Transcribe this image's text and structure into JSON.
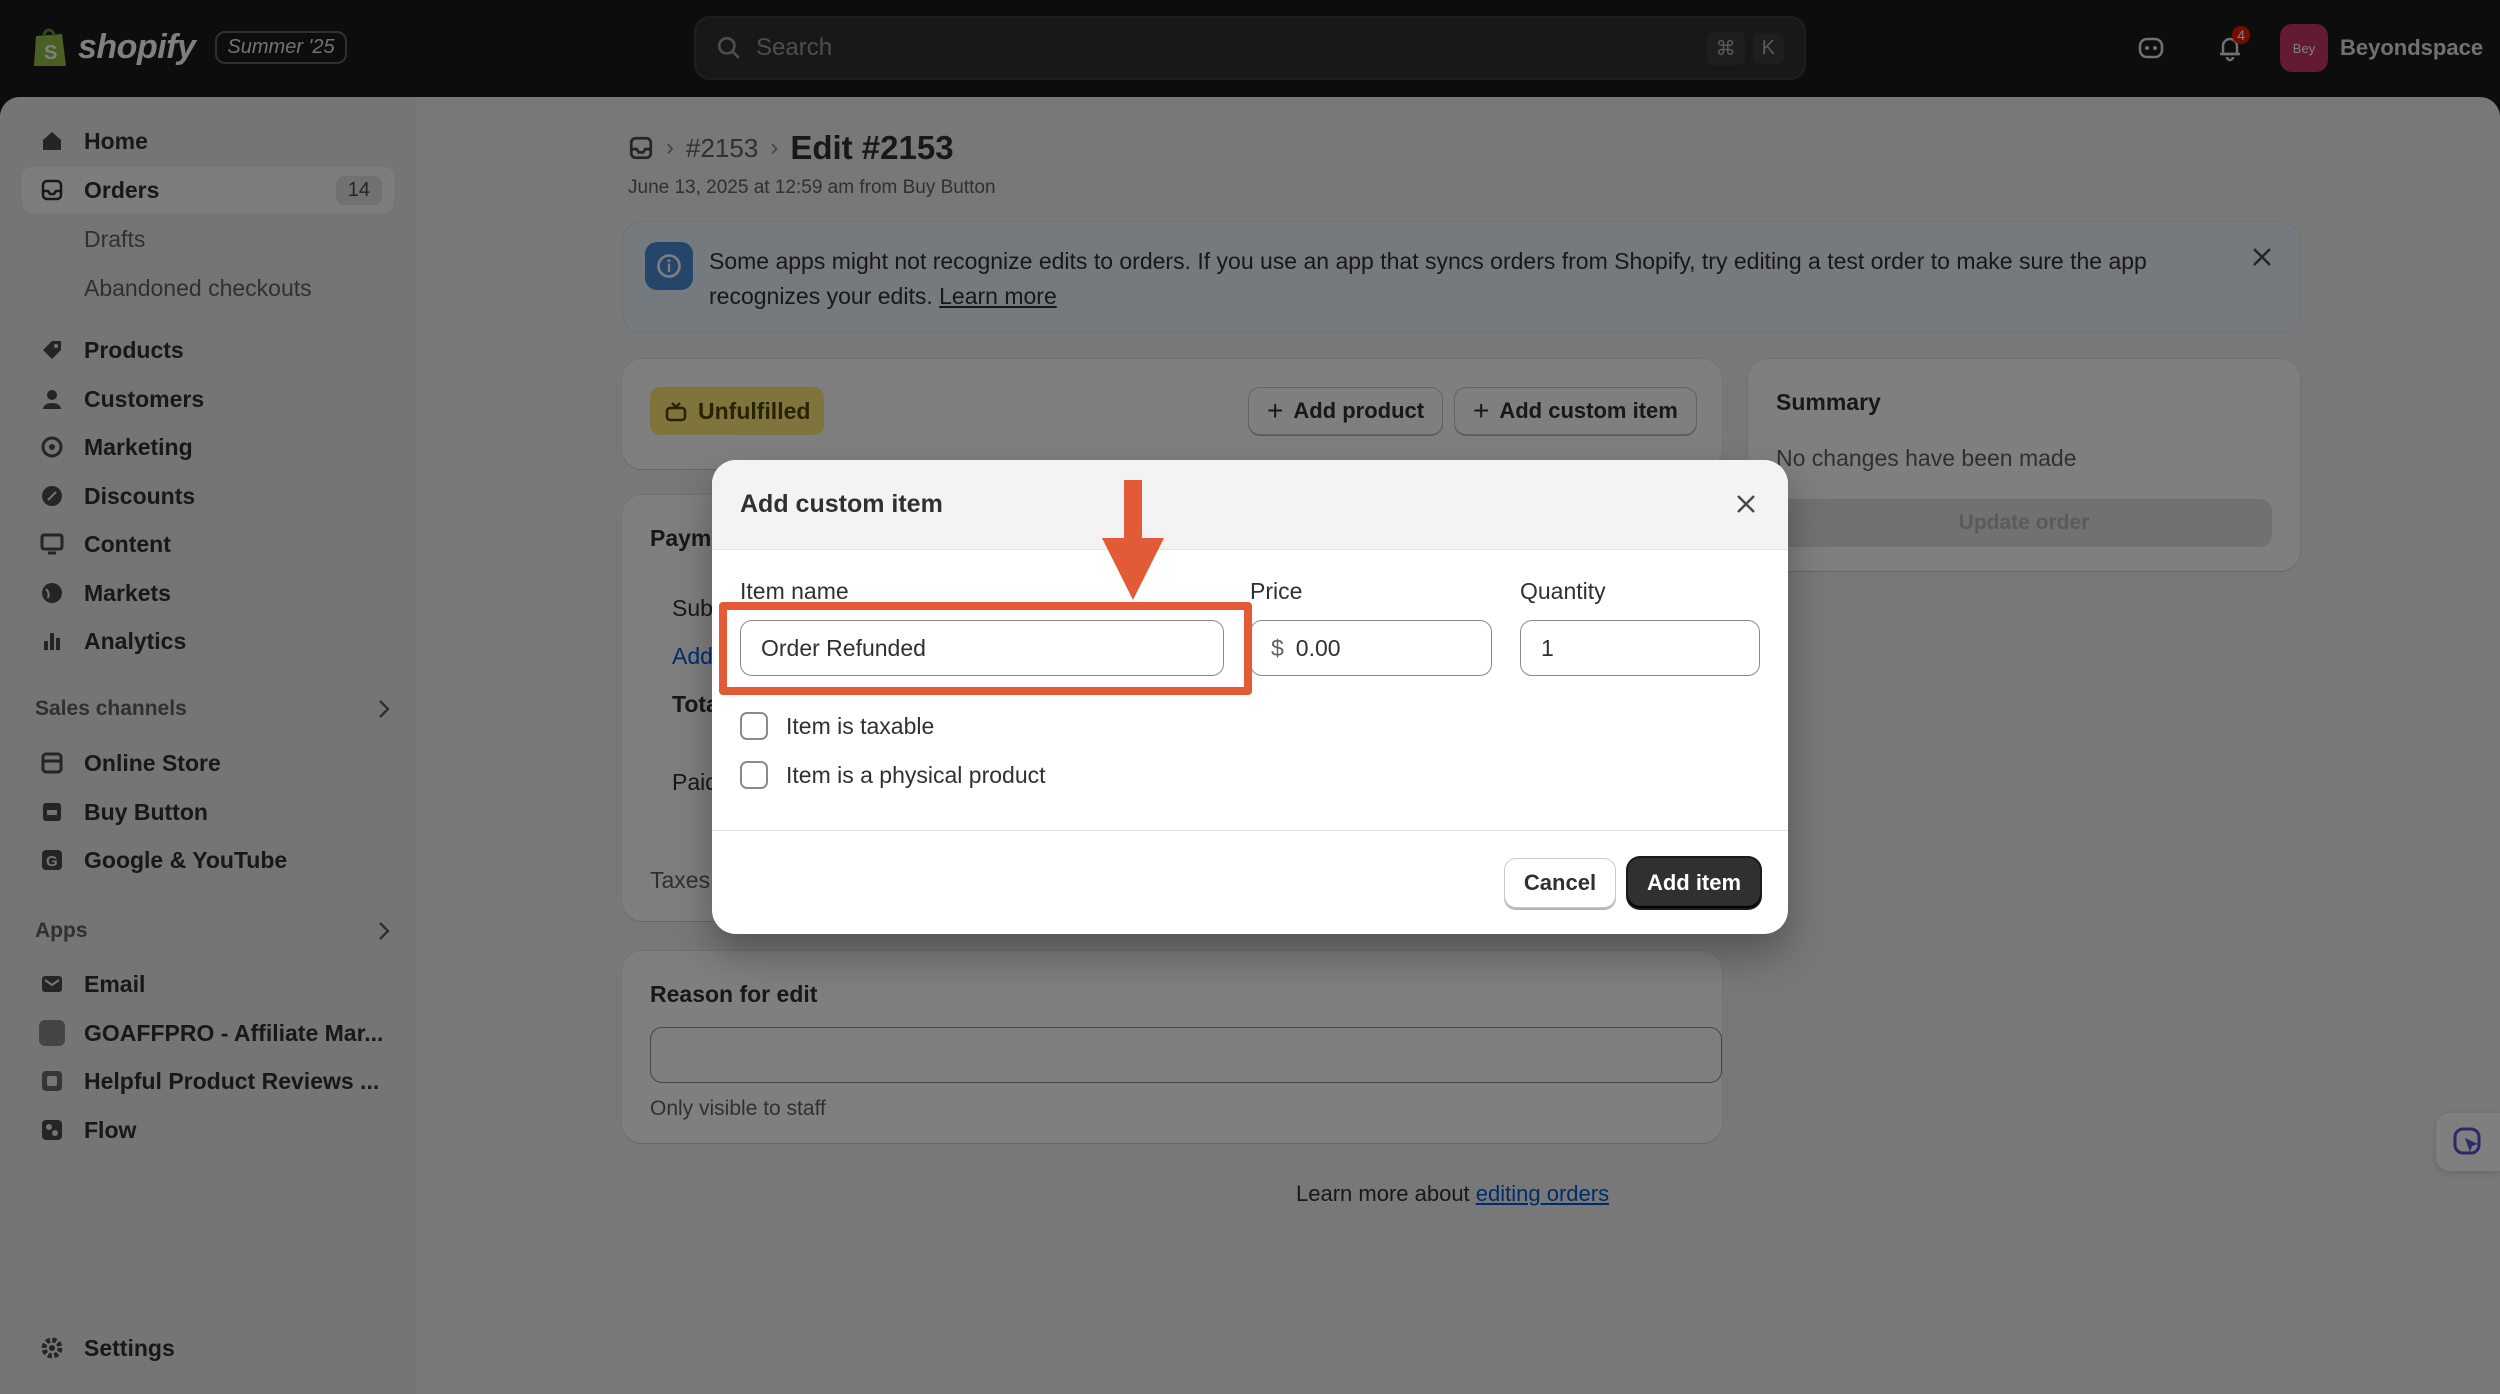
{
  "topbar": {
    "brand": "shopify",
    "edition": "Summer '25",
    "search_placeholder": "Search",
    "shortcut_keys": [
      "⌘",
      "K"
    ],
    "notifications_count": "4",
    "account_initials": "Bey",
    "account_name": "Beyondspace"
  },
  "sidebar": {
    "items": [
      {
        "label": "Home",
        "icon": "home-icon"
      },
      {
        "label": "Orders",
        "icon": "inbox-icon",
        "count": "14"
      },
      {
        "label": "Drafts"
      },
      {
        "label": "Abandoned checkouts"
      },
      {
        "label": "Products",
        "icon": "tag-icon"
      },
      {
        "label": "Customers",
        "icon": "person-icon"
      },
      {
        "label": "Marketing",
        "icon": "target-icon"
      },
      {
        "label": "Discounts",
        "icon": "discount-icon"
      },
      {
        "label": "Content",
        "icon": "monitor-icon"
      },
      {
        "label": "Markets",
        "icon": "globe-icon"
      },
      {
        "label": "Analytics",
        "icon": "bar-chart-icon"
      }
    ],
    "sales_channels_heading": "Sales channels",
    "sales_channels": [
      "Online Store",
      "Buy Button",
      "Google & YouTube"
    ],
    "apps_heading": "Apps",
    "apps": [
      "Email",
      "GOAFFPRO - Affiliate Mar...",
      "Helpful Product Reviews ...",
      "Flow"
    ],
    "settings": "Settings"
  },
  "page": {
    "breadcrumb_order": "#2153",
    "title": "Edit #2153",
    "subtitle": "June 13, 2025 at 12:59 am from Buy Button",
    "banner_text": "Some apps might not recognize edits to orders. If you use an app that syncs orders from Shopify, try editing a test order to make sure the app recognizes your edits.",
    "banner_link": "Learn more",
    "status_badge": "Unfulfilled",
    "add_product": "Add product",
    "add_custom_item": "Add custom item",
    "payment_fragments": {
      "title": "Paym",
      "sub": "Sub",
      "add": "Add",
      "total": "Tota",
      "paid": "Paid",
      "taxes": "Taxes"
    },
    "summary_title": "Summary",
    "summary_text": "No changes have been made",
    "update_order": "Update order",
    "reason_title": "Reason for edit",
    "reason_hint": "Only visible to staff",
    "help_prefix": "Learn more about",
    "help_link": "editing orders"
  },
  "modal": {
    "title": "Add custom item",
    "item_name_label": "Item name",
    "item_name_value": "Order Refunded",
    "price_label": "Price",
    "price_prefix": "$",
    "price_value": "0.00",
    "quantity_label": "Quantity",
    "quantity_value": "1",
    "taxable_label": "Item is taxable",
    "physical_label": "Item is a physical product",
    "cancel": "Cancel",
    "add_item": "Add item"
  },
  "colors": {
    "annotation": "#e35a36",
    "badge_unfulfilled": "#ffeb78",
    "link": "#005bd3",
    "primary_button": "#303030"
  }
}
